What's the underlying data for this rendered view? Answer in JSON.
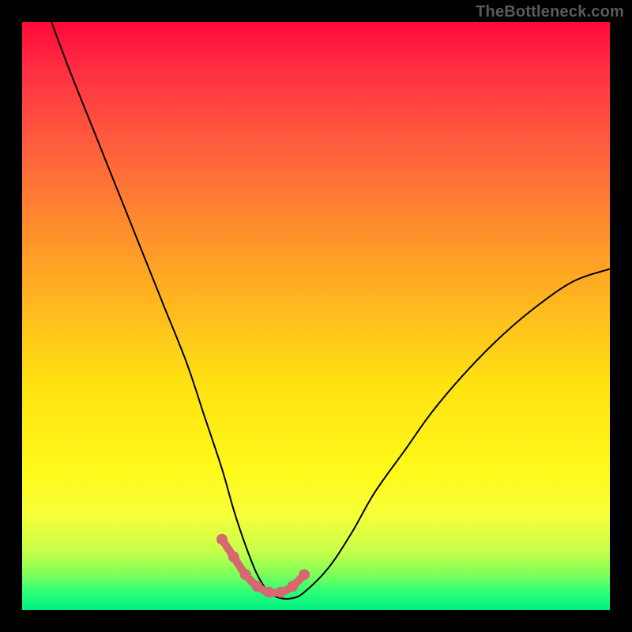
{
  "watermark": "TheBottleneck.com",
  "colors": {
    "background": "#000000",
    "curve": "#000000",
    "marker_stroke": "#d46a6f",
    "marker_fill": "#d46a6f",
    "gradient_top": "#ff0a3a",
    "gradient_bottom": "#00ef82"
  },
  "chart_data": {
    "type": "line",
    "title": "",
    "xlabel": "",
    "ylabel": "",
    "xlim": [
      0,
      100
    ],
    "ylim": [
      0,
      100
    ],
    "grid": false,
    "legend": false,
    "series": [
      {
        "name": "bottleneck-curve",
        "x": [
          5,
          8,
          12,
          16,
          20,
          24,
          28,
          31,
          34,
          36,
          38,
          40,
          42,
          44,
          46,
          48,
          52,
          56,
          60,
          65,
          70,
          76,
          82,
          88,
          94,
          100
        ],
        "values": [
          100,
          92,
          82,
          72,
          62,
          52,
          42,
          33,
          24,
          17,
          11,
          6,
          3,
          2,
          2,
          3,
          7,
          13,
          20,
          27,
          34,
          41,
          47,
          52,
          56,
          58
        ]
      }
    ],
    "annotations": [
      {
        "name": "notch-markers",
        "style": "thick-dots-and-line",
        "color": "#d46a6f",
        "x": [
          34,
          36,
          38,
          40,
          42,
          44,
          46,
          48
        ],
        "values": [
          12,
          9,
          6,
          4,
          3,
          3,
          4,
          6
        ]
      }
    ]
  }
}
